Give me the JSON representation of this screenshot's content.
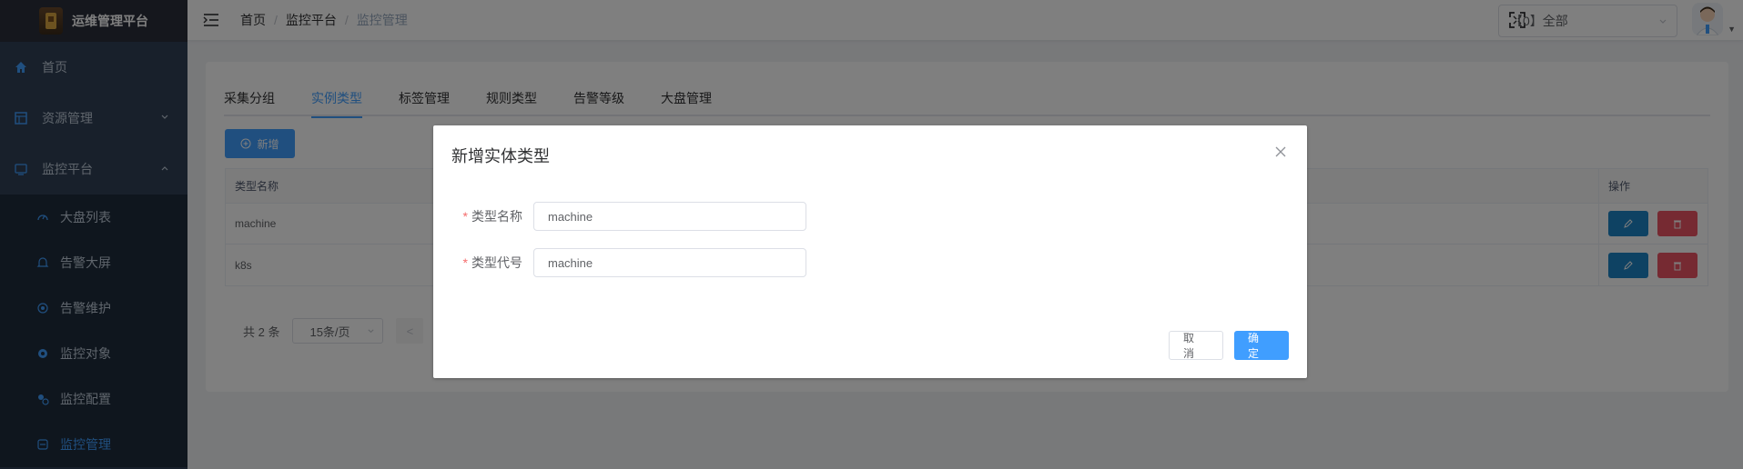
{
  "app": {
    "title": "运维管理平台"
  },
  "sidebar": {
    "home": "首页",
    "resource": "资源管理",
    "monitor": "监控平台",
    "sub_items": [
      "大盘列表",
      "告警大屏",
      "告警维护",
      "监控对象",
      "监控配置",
      "监控管理"
    ]
  },
  "header": {
    "breadcrumb": [
      "首页",
      "监控平台",
      "监控管理"
    ],
    "tenant": "【0】全部"
  },
  "main": {
    "tabs": [
      "采集分组",
      "实例类型",
      "标签管理",
      "规则类型",
      "告警等级",
      "大盘管理"
    ],
    "active_tab": "实例类型",
    "add_button": "新增",
    "table": {
      "columns": [
        "类型名称",
        "操作"
      ],
      "rows": [
        {
          "name": "machine"
        },
        {
          "name": "k8s"
        }
      ]
    },
    "pagination": {
      "total": "共 2 条",
      "page_size": "15条/页",
      "prev": "<"
    }
  },
  "dialog": {
    "title": "新增实体类型",
    "fields": [
      {
        "label": "类型名称",
        "value": "machine"
      },
      {
        "label": "类型代号",
        "value": "machine"
      }
    ],
    "cancel": "取 消",
    "confirm": "确 定"
  },
  "colors": {
    "primary": "#409eff",
    "sidebar": "#304156",
    "danger": "#ed5565",
    "edit": "#1c84c6"
  }
}
